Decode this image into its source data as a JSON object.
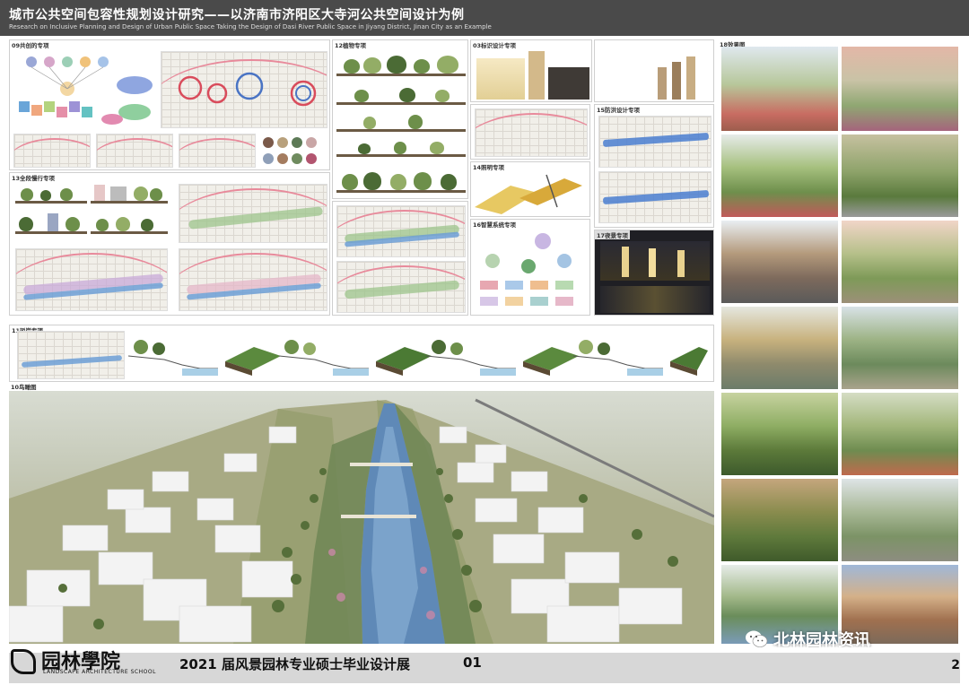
{
  "header": {
    "title_cn": "城市公共空间包容性规划设计研究——以济南市济阳区大寺河公共空间设计为例",
    "title_en": "Research on Inclusive Planning and Design of Urban Public Space    Taking the Design of Dasi River Public Space in Jiyang District, Jinan City as an Example"
  },
  "sections": {
    "s09": "09共创的专项",
    "s12": "12植物专项",
    "s13": "13全段慢行专项",
    "s11": "11驳岸专项",
    "s10": "10鸟瞰图",
    "s14": "14照明专项",
    "s15": "15防洪设计专项",
    "s16": "16智慧系统专项",
    "s17": "17夜景专项",
    "s18": "18效果图",
    "s03": "03标识设计专项"
  },
  "footer": {
    "logo_cn": "园林學院",
    "logo_sub": "LANDSCAPE ARCHITECTURE SCHOOL",
    "exhibition": "2021 届风景园林专业硕士毕业设计展",
    "sheet": "01",
    "page": "2"
  },
  "watermark": {
    "text": "北林园林资讯",
    "icon": "wechat-icon"
  },
  "colors": {
    "header_bg": "#4a4a4a",
    "footer_bg": "#d7d7d7",
    "road_pink": "#e88a9b",
    "river_blue": "#6d9fd6"
  }
}
